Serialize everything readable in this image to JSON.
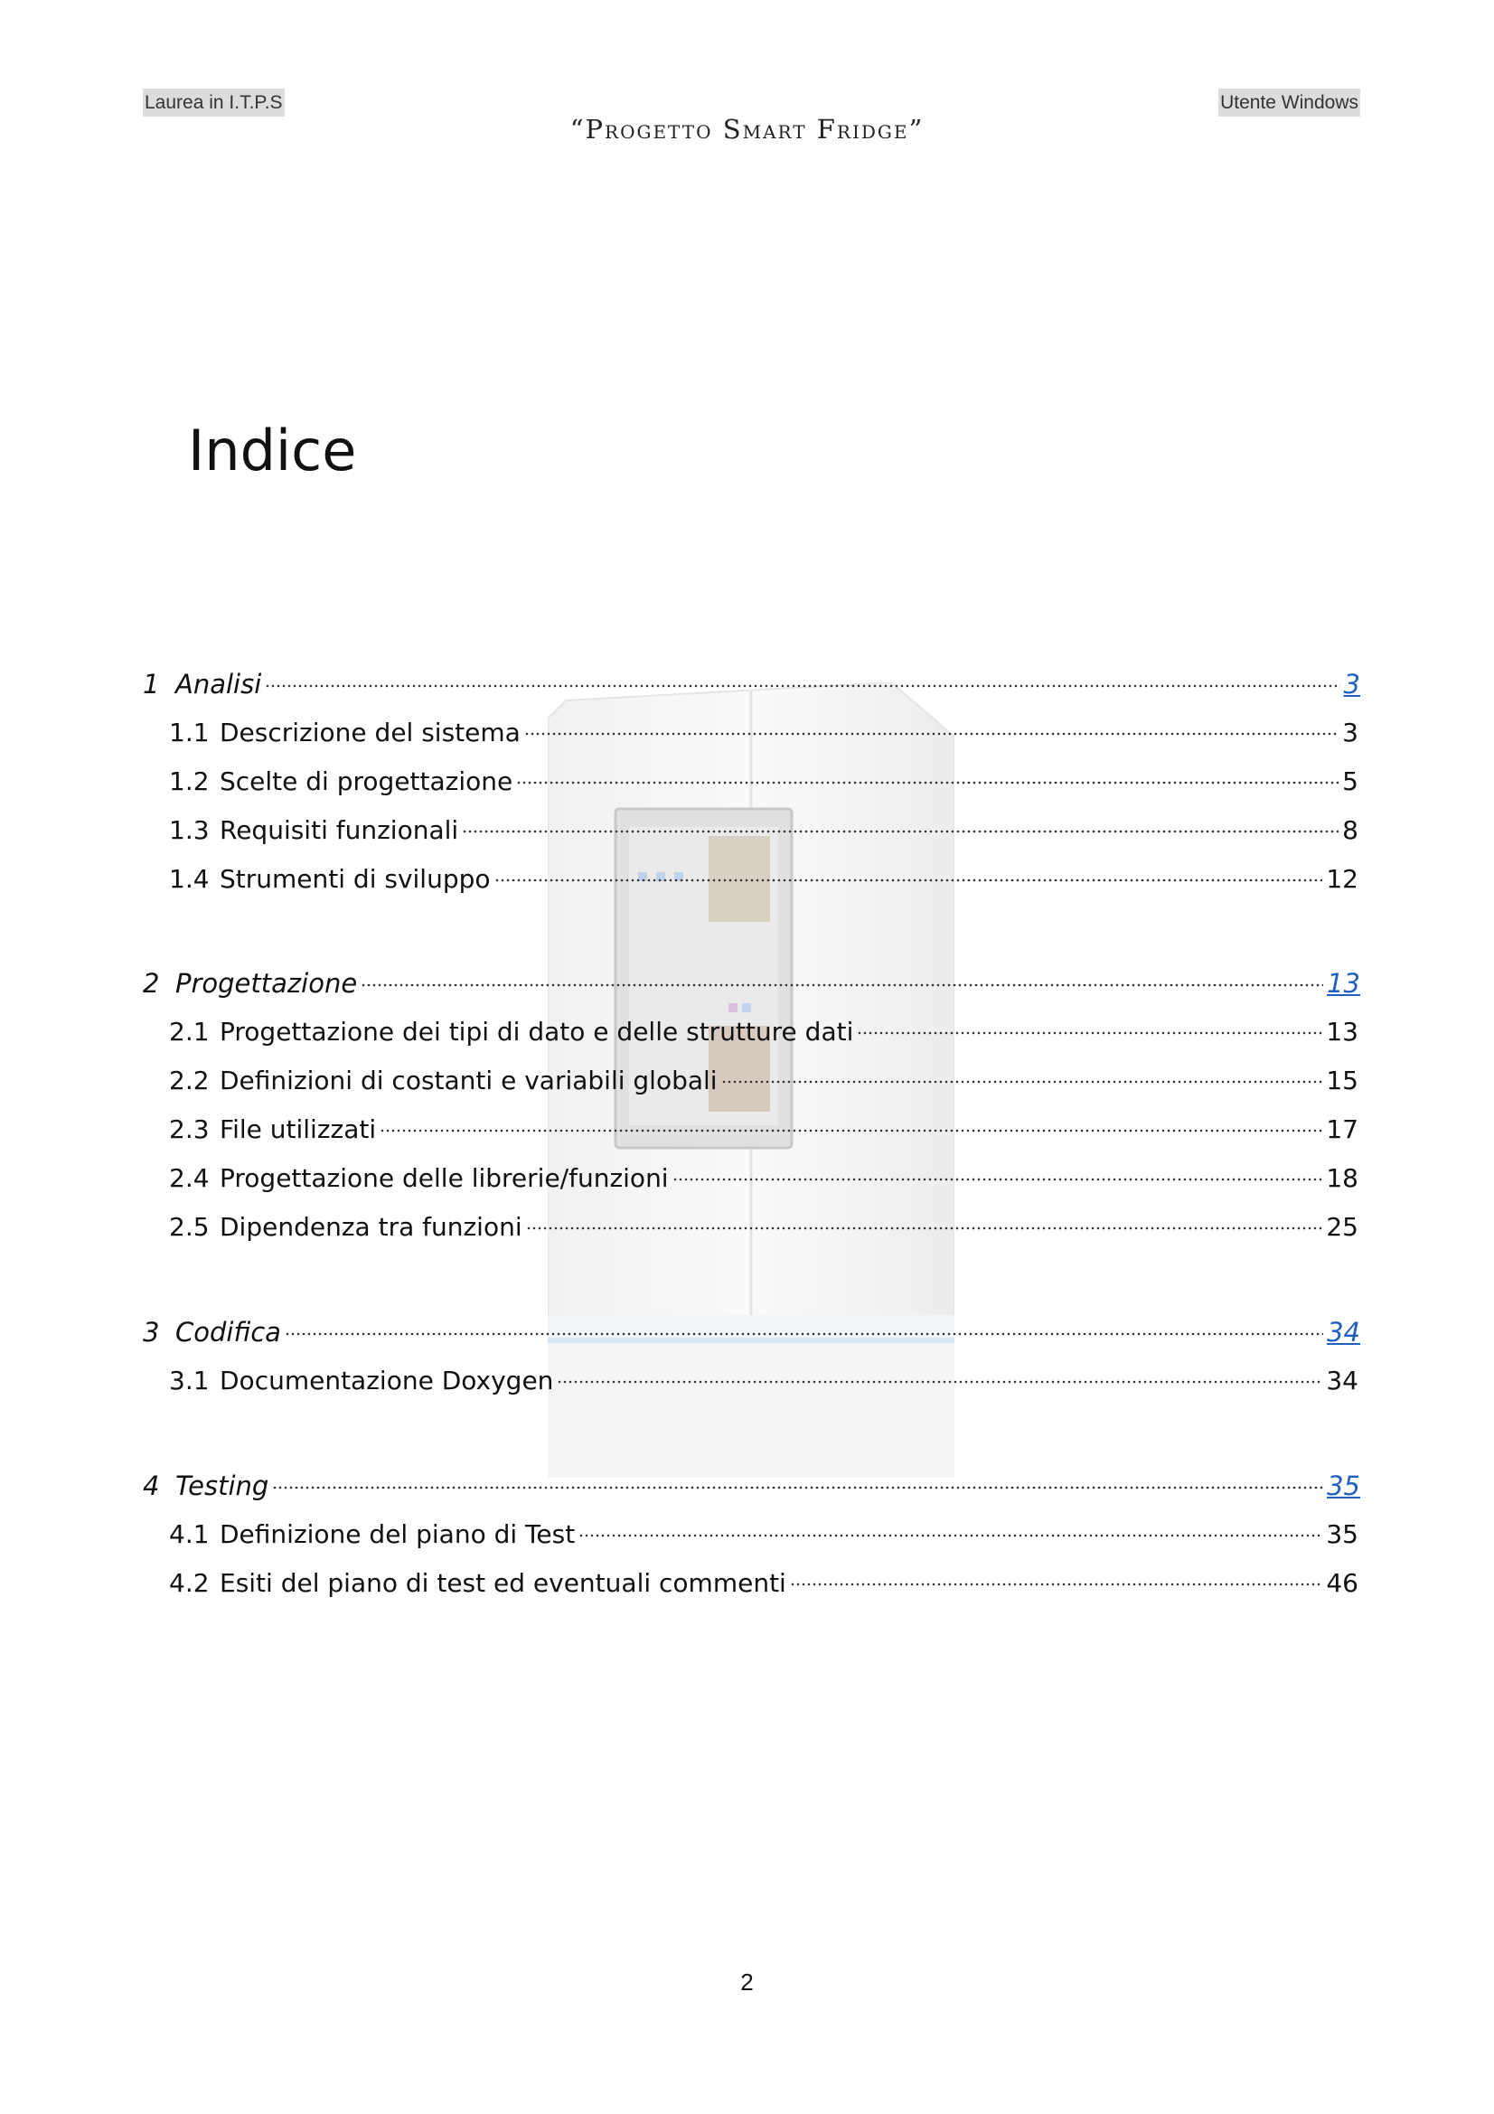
{
  "header": {
    "left": "Laurea in I.T.P.S",
    "right": "Utente Windows",
    "center": "“Progetto Smart Fridge”"
  },
  "title": "Indice",
  "toc": [
    {
      "num": "1",
      "label": "Analisi",
      "page": "3",
      "level": "chapter"
    },
    {
      "num": "1.1",
      "label": "Descrizione del sistema",
      "page": "3",
      "level": "section"
    },
    {
      "num": "1.2",
      "label": "Scelte di progettazione",
      "page": "5",
      "level": "section"
    },
    {
      "num": "1.3",
      "label": "Requisiti funzionali",
      "page": "8",
      "level": "section"
    },
    {
      "num": "1.4",
      "label": "Strumenti di sviluppo",
      "page": "12",
      "level": "section"
    },
    {
      "num": "2",
      "label": "Progettazione",
      "page": "13",
      "level": "chapter"
    },
    {
      "num": "2.1",
      "label": "Progettazione dei tipi di dato e delle strutture dati",
      "page": "13",
      "level": "section"
    },
    {
      "num": "2.2",
      "label": "Definizioni di costanti e variabili globali",
      "page": "15",
      "level": "section"
    },
    {
      "num": "2.3",
      "label": "File utilizzati",
      "page": "17",
      "level": "section"
    },
    {
      "num": "2.4",
      "label": "Progettazione delle librerie/funzioni",
      "page": "18",
      "level": "section"
    },
    {
      "num": "2.5",
      "label": "Dipendenza tra funzioni",
      "page": "25",
      "level": "section"
    },
    {
      "num": "3",
      "label": "Codifica",
      "page": "34",
      "level": "chapter"
    },
    {
      "num": "3.1",
      "label": "Documentazione Doxygen",
      "page": "34",
      "level": "section"
    },
    {
      "num": "4",
      "label": "Testing",
      "page": "35",
      "level": "chapter"
    },
    {
      "num": "4.1",
      "label": "Definizione del piano di Test",
      "page": "35",
      "level": "section"
    },
    {
      "num": "4.2",
      "label": "Esiti del piano di test ed eventuali commenti",
      "page": "46",
      "level": "section"
    }
  ],
  "footer": {
    "page_number": "2"
  },
  "colors": {
    "link": "#1f5fbf",
    "header_highlight": "#dcdcdc"
  },
  "icons": {
    "watermark": "smart-fridge-watermark"
  }
}
